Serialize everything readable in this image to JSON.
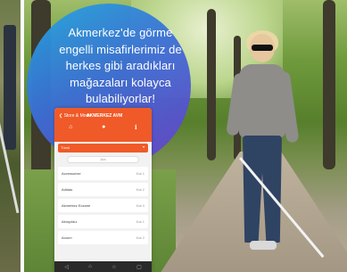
{
  "overlay": {
    "message_lines": [
      "Akmerkez'de görme",
      "engelli misafirlerimiz de",
      "herkes gibi aradıkları",
      "mağazaları kolayca",
      "bulabiliyorlar!"
    ]
  },
  "phone": {
    "back_label": "❮ Store & Mode",
    "title": "AKMERKEZ AVM",
    "tab_icons": [
      "home-icon",
      "pin-icon",
      "info-icon"
    ],
    "tab_glyphs": [
      "⌂",
      "●",
      "ℹ"
    ],
    "select_label": "Tümü",
    "select_caret": "▾",
    "search_label": "Ara",
    "rows": [
      {
        "name": "Accessorize",
        "floor": "Kat 1"
      },
      {
        "name": "Adidas",
        "floor": "Kat 2"
      },
      {
        "name": "Akmerkez Eczane",
        "floor": "Kat 0"
      },
      {
        "name": "Altınyıldız",
        "floor": "Kat 1"
      },
      {
        "name": "Arzum",
        "floor": "Kat 2"
      }
    ],
    "bottom_icons": [
      "back-icon",
      "home-nav-icon",
      "star-icon",
      "recent-icon"
    ],
    "bottom_glyphs": [
      "◁",
      "⌂",
      "☆",
      "▢"
    ]
  },
  "colors": {
    "accent": "#f05a28",
    "bubble": "#3b6fd6"
  }
}
